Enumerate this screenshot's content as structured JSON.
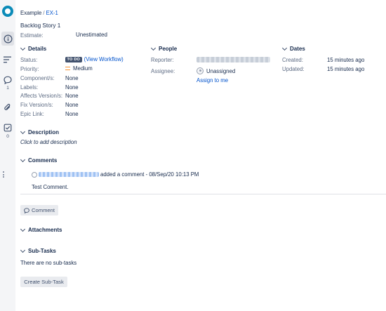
{
  "breadcrumb": {
    "project": "Example",
    "separator": "/",
    "issue_key": "EX-1"
  },
  "issue": {
    "summary": "Backlog Story 1",
    "estimate_label": "Estimate:",
    "estimate_value": "Unestimated"
  },
  "sidebar": {
    "icons": [
      "info-icon",
      "menu-lines-icon",
      "comment-icon",
      "paperclip-icon",
      "checklist-icon"
    ],
    "comment_count": "1",
    "subtask_count": "0"
  },
  "details": {
    "heading": "Details",
    "status_label": "Status:",
    "status_badge": "TO DO",
    "status_open": "(",
    "status_link": "View Workflow",
    "status_close": ")",
    "priority_label": "Priority:",
    "priority_value": "Medium",
    "components_label": "Component/s:",
    "components_value": "None",
    "labels_label": "Labels:",
    "labels_value": "None",
    "affects_label": "Affects Version/s:",
    "affects_value": "None",
    "fix_label": "Fix Version/s:",
    "fix_value": "None",
    "epic_label": "Epic Link:",
    "epic_value": "None"
  },
  "people": {
    "heading": "People",
    "reporter_label": "Reporter:",
    "assignee_label": "Assignee:",
    "assignee_value": "Unassigned",
    "assign_to_me": "Assign to me"
  },
  "dates": {
    "heading": "Dates",
    "created_label": "Created:",
    "created_value": "15 minutes ago",
    "updated_label": "Updated:",
    "updated_value": "15 minutes ago"
  },
  "description": {
    "heading": "Description",
    "placeholder": "Click to add description"
  },
  "comments": {
    "heading": "Comments",
    "action_text": "added a comment - 08/Sep/20 10:13 PM",
    "body": "Test Comment.",
    "button": "Comment"
  },
  "attachments": {
    "heading": "Attachments"
  },
  "subtasks": {
    "heading": "Sub-Tasks",
    "empty": "There are no sub-tasks",
    "button": "Create Sub-Task"
  },
  "colors": {
    "link": "#0052cc",
    "todo_badge": "#42526e",
    "priority_medium": "#f79232",
    "rail": "#f4f5f7"
  }
}
